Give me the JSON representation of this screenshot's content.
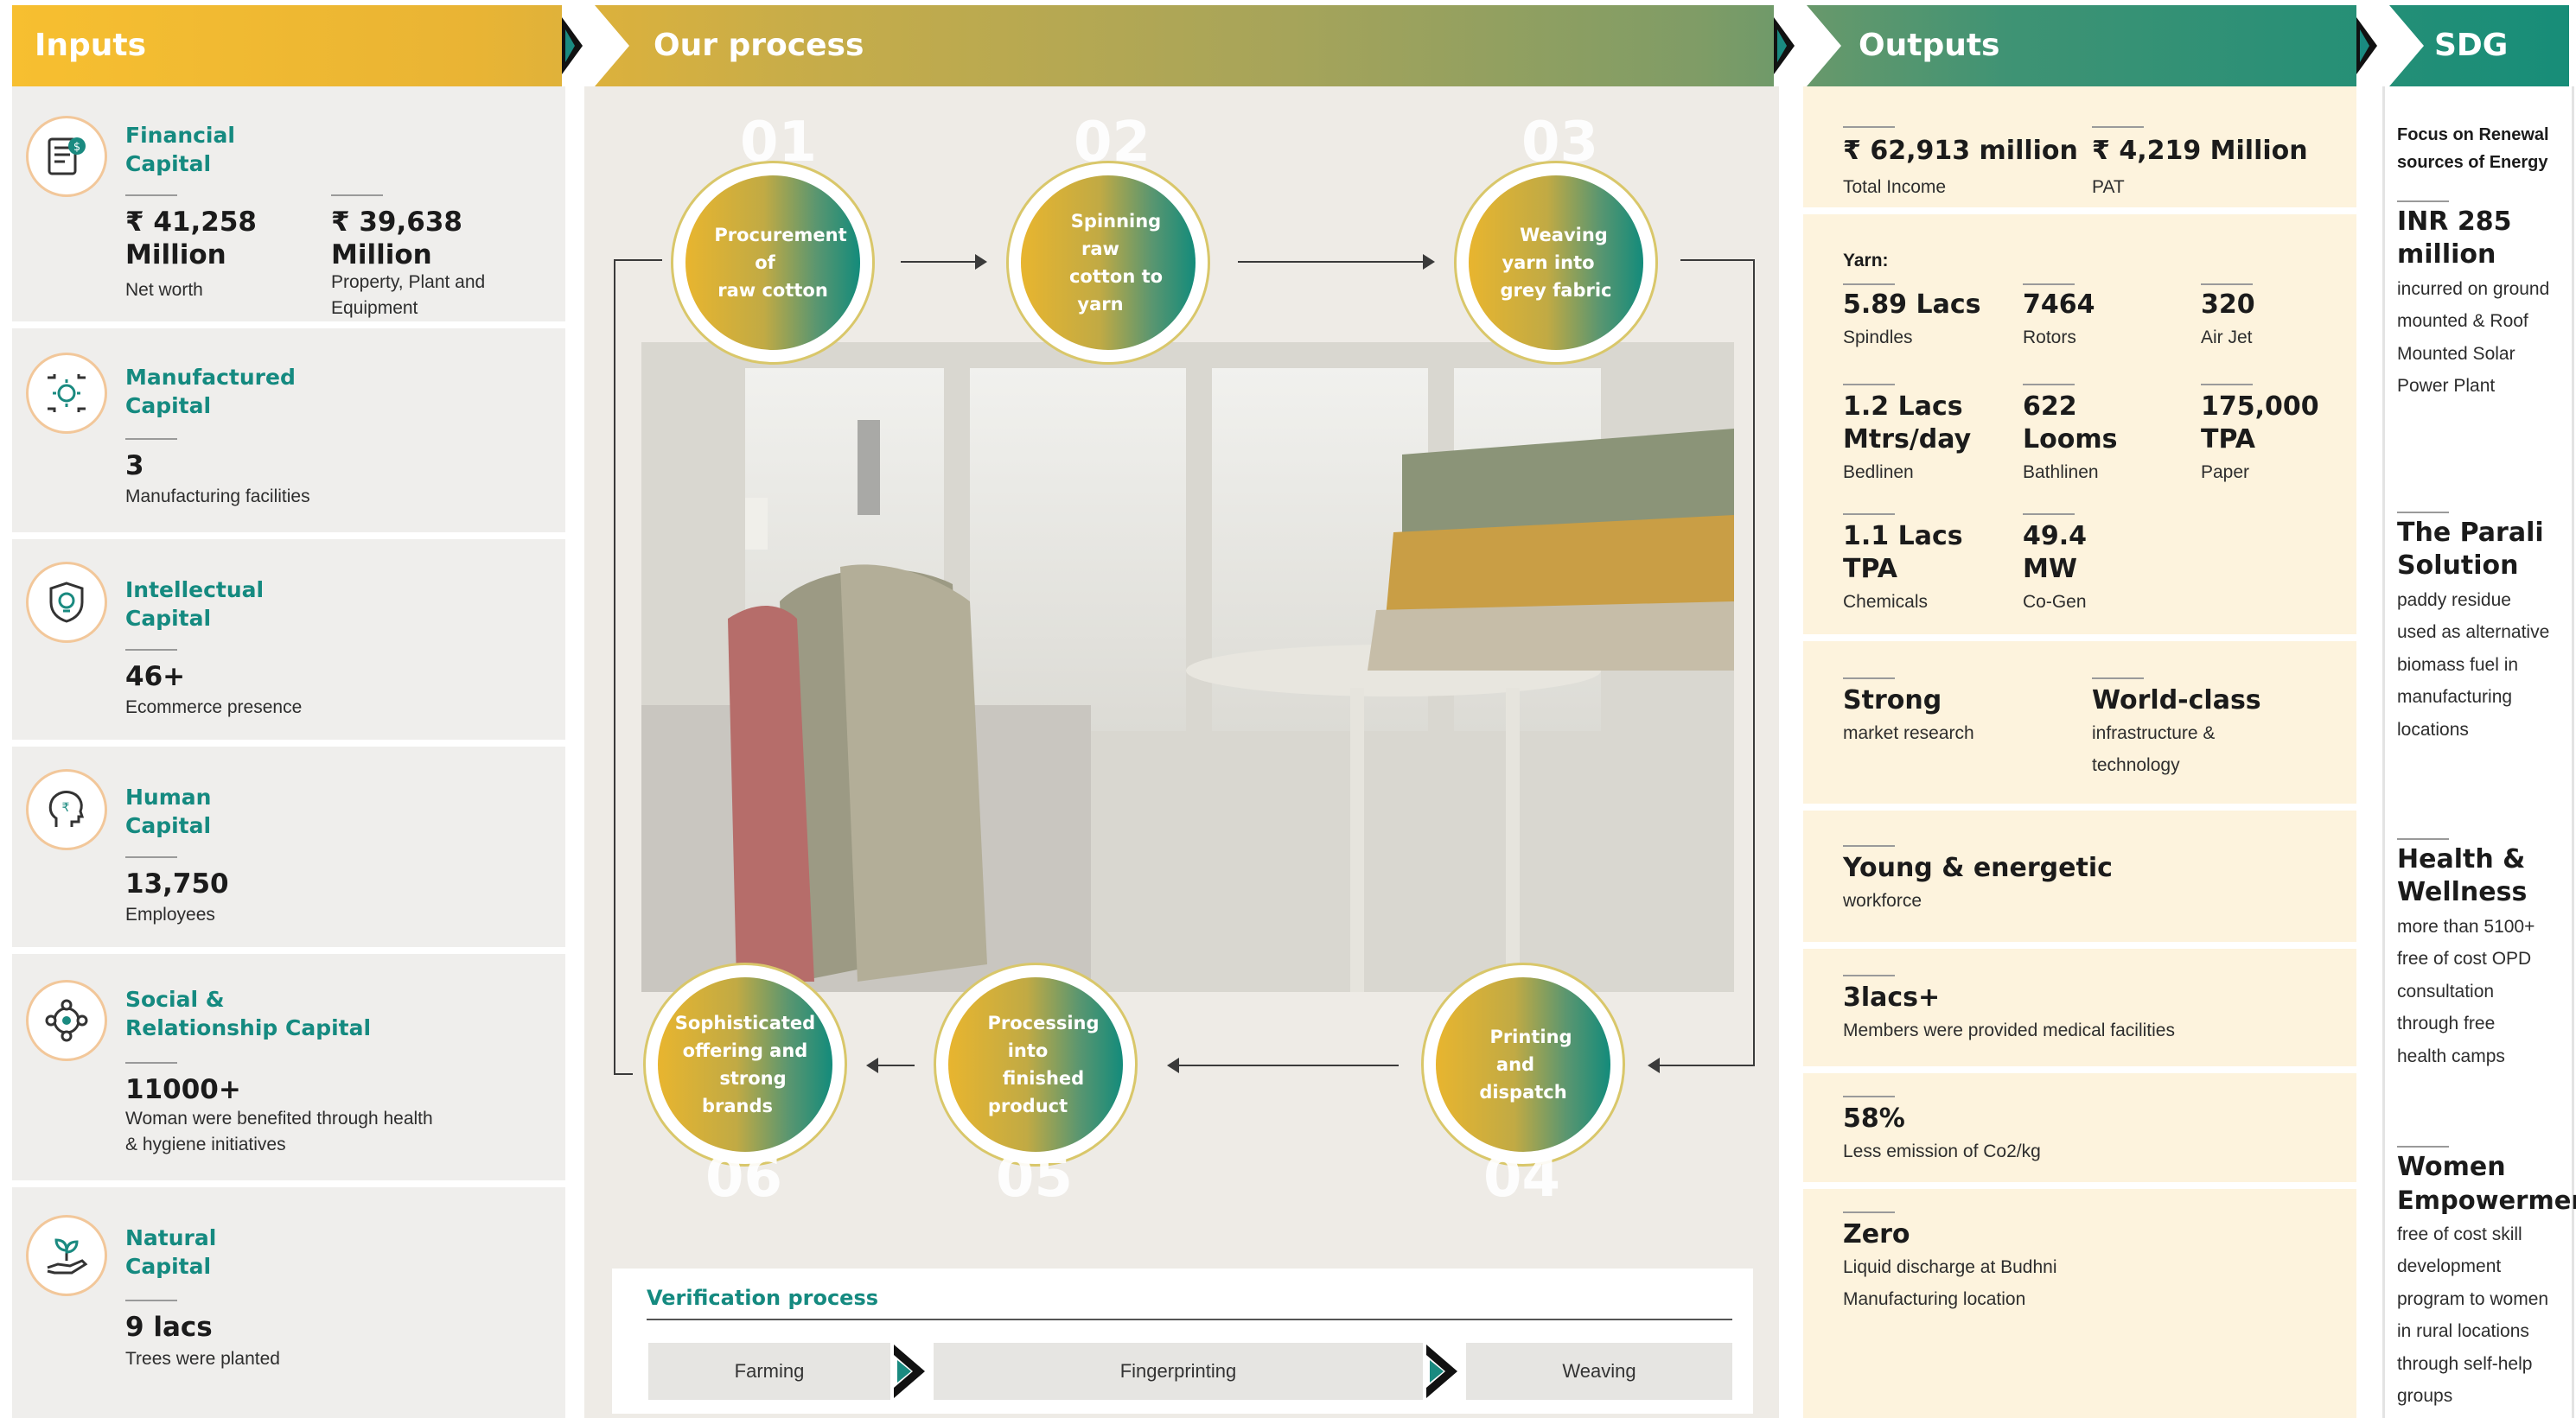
{
  "headers": {
    "inputs": "Inputs",
    "process": "Our process",
    "outputs": "Outputs",
    "sdg": "SDG"
  },
  "inputs": [
    {
      "title_1": "Financial",
      "title_2": "Capital",
      "icon": "finance-icon",
      "val_a_1": "₹ 41,258",
      "val_a_2": "Million",
      "sub_a": "Net worth",
      "val_b_1": "₹ 39,638",
      "val_b_2": "Million",
      "sub_b_1": "Property, Plant and",
      "sub_b_2": "Equipment"
    },
    {
      "title_1": "Manufactured",
      "title_2": "Capital",
      "icon": "manufacturing-icon",
      "value": "3",
      "sub": "Manufacturing facilities"
    },
    {
      "title_1": "Intellectual",
      "title_2": "Capital",
      "icon": "idea-shield-icon",
      "value": "46+",
      "sub": "Ecommerce presence"
    },
    {
      "title_1": "Human",
      "title_2": "Capital",
      "icon": "human-head-icon",
      "value": "13,750",
      "sub": "Employees"
    },
    {
      "title_1": "Social &",
      "title_2": "Relationship Capital",
      "icon": "network-icon",
      "value": "11000+",
      "sub_1": "Woman were benefited through health",
      "sub_2": "& hygiene initiatives"
    },
    {
      "title_1": "Natural",
      "title_2": "Capital",
      "icon": "plant-hand-icon",
      "value": "9 lacs",
      "sub": "Trees were planted"
    }
  ],
  "process": {
    "steps": [
      {
        "num": "01",
        "label_1": "Procurement of",
        "label_2": "raw cotton"
      },
      {
        "num": "02",
        "label_1": "Spinning raw",
        "label_2": "cotton to yarn"
      },
      {
        "num": "03",
        "label_1": "Weaving yarn into",
        "label_2": "grey fabric"
      },
      {
        "num": "04",
        "label_1": "Printing and",
        "label_2": "dispatch"
      },
      {
        "num": "05",
        "label_1": "Processing into",
        "label_2": "finished product"
      },
      {
        "num": "06",
        "label_1": "Sophisticated",
        "label_2": "offering and",
        "label_3": "strong brands"
      }
    ],
    "verification": {
      "title": "Verification process",
      "stages": [
        "Farming",
        "Fingerprinting",
        "Weaving"
      ]
    }
  },
  "outputs": {
    "financial": [
      {
        "value": "₹ 62,913 million",
        "sub": "Total Income"
      },
      {
        "value": "₹ 4,219 Million",
        "sub": "PAT"
      }
    ],
    "yarn_label": "Yarn:",
    "grid": [
      {
        "v1": "5.89 Lacs",
        "sub": "Spindles"
      },
      {
        "v1": "7464",
        "sub": "Rotors"
      },
      {
        "v1": "320",
        "sub": "Air Jet"
      },
      {
        "v1": "1.2 Lacs",
        "v2": "Mtrs/day",
        "sub": "Bedlinen"
      },
      {
        "v1": "622",
        "v2": "Looms",
        "sub": "Bathlinen"
      },
      {
        "v1": "175,000",
        "v2": "TPA",
        "sub": "Paper"
      },
      {
        "v1": "1.1 Lacs",
        "v2": "TPA",
        "sub": "Chemicals"
      },
      {
        "v1": "49.4",
        "v2": "MW",
        "sub": "Co-Gen"
      }
    ],
    "strong": {
      "value": "Strong",
      "sub": "market research"
    },
    "world": {
      "value": "World-class",
      "sub_1": "infrastructure &",
      "sub_2": "technology"
    },
    "young": {
      "value": "Young & energetic",
      "sub": "workforce"
    },
    "medical": {
      "value": "3lacs+",
      "sub": "Members were provided medical facilities"
    },
    "emission": {
      "value": "58%",
      "sub": "Less emission of Co2/kg"
    },
    "zero": {
      "value": "Zero",
      "sub_1": "Liquid discharge at Budhni",
      "sub_2": "Manufacturing location"
    }
  },
  "sdg": {
    "focus_1": "Focus on Renewal",
    "focus_2": "sources of Energy",
    "items": [
      {
        "v1": "INR 285",
        "v2": "million",
        "lines": [
          "incurred on ground",
          "mounted & Roof",
          "Mounted Solar",
          "Power Plant"
        ]
      },
      {
        "v1": "The Parali",
        "v2": "Solution",
        "lines": [
          "paddy residue",
          "used as alternative",
          "biomass fuel in",
          "manufacturing",
          "locations"
        ]
      },
      {
        "v1": "Health &",
        "v2": "Wellness",
        "lines": [
          "more than 5100+",
          "free of cost OPD",
          "consultation",
          "through free",
          "health camps"
        ]
      },
      {
        "v1": "Women",
        "v2": "Empowerment",
        "lines": [
          "free of cost skill",
          "development",
          "program to women",
          "in rural locations",
          "through self-help",
          "groups"
        ]
      }
    ]
  }
}
